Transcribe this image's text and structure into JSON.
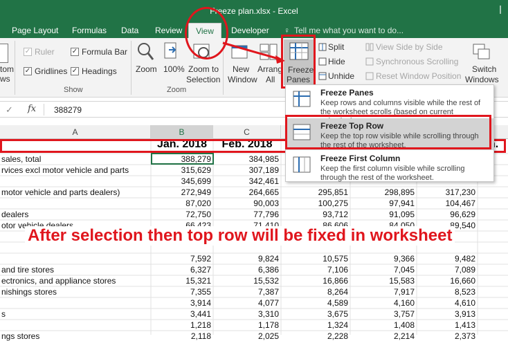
{
  "window": {
    "title": "Freeze plan.xlsx - Excel"
  },
  "tabs": [
    {
      "label": "Page Layout"
    },
    {
      "label": "Formulas"
    },
    {
      "label": "Data"
    },
    {
      "label": "Review"
    },
    {
      "label": "View",
      "active": true
    },
    {
      "label": "Developer"
    }
  ],
  "tell_me": {
    "placeholder": "Tell me what you want to do..."
  },
  "ribbon": {
    "workbook_views_partial": [
      "tom",
      "ws"
    ],
    "show": {
      "group": "Show",
      "ruler": "Ruler",
      "formula_bar": "Formula Bar",
      "gridlines": "Gridlines",
      "headings": "Headings"
    },
    "zoom": {
      "group": "Zoom",
      "zoom": "Zoom",
      "zoom100": "100%",
      "zoom_sel_1": "Zoom to",
      "zoom_sel_2": "Selection"
    },
    "window": {
      "new_window_1": "New",
      "new_window_2": "Window",
      "arrange_1": "Arrang",
      "arrange_2": "All",
      "freeze_1": "Freeze",
      "freeze_2": "Panes",
      "split": "Split",
      "hide": "Hide",
      "unhide": "Unhide",
      "view_side": "View Side by Side",
      "sync_scroll": "Synchronous Scrolling",
      "reset_pos": "Reset Window Position",
      "switch_1": "Switch",
      "switch_2": "Windows"
    }
  },
  "formula_bar": {
    "cancel": "✓",
    "fx": "fx",
    "value": "388279"
  },
  "columns": [
    "A",
    "B",
    "C"
  ],
  "sheet": {
    "header_b": "Jan. 2018",
    "header_c": "Feb. 2018",
    "header_right": "n.",
    "rows": [
      {
        "a": "sales, total",
        "b": "388,279",
        "c": "384,985"
      },
      {
        "a": "rvices excl motor vehicle and parts",
        "b": "315,629",
        "c": "307,189"
      },
      {
        "a": "",
        "b": "345,699",
        "c": "342,461"
      },
      {
        "a": "motor vehicle and parts dealers)",
        "b": "272,949",
        "c": "264,665",
        "d": "295,851",
        "e": "298,895",
        "f": "317,230"
      },
      {
        "a": "",
        "b": "87,020",
        "c": "90,003",
        "d": "100,275",
        "e": "97,941",
        "f": "104,467"
      },
      {
        "a": "dealers",
        "b": "72,750",
        "c": "77,796",
        "d": "93,712",
        "e": "91,095",
        "f": "96,629"
      },
      {
        "a": "otor vehicle dealers",
        "b": "66,423",
        "c": "71,410",
        "d": "86,606",
        "e": "84,050",
        "f": "89,540"
      },
      {
        "a": "",
        "b": "7,592",
        "c": "9,824",
        "d": "10,575",
        "e": "9,366",
        "f": "9,482"
      },
      {
        "a": "and tire stores",
        "b": "6,327",
        "c": "6,386",
        "d": "7,106",
        "e": "7,045",
        "f": "7,089"
      },
      {
        "a": "ectronics, and appliance stores",
        "b": "15,321",
        "c": "15,532",
        "d": "16,866",
        "e": "15,583",
        "f": "16,660"
      },
      {
        "a": "nishings stores",
        "b": "7,355",
        "c": "7,387",
        "d": "8,264",
        "e": "7,917",
        "f": "8,523"
      },
      {
        "a": "",
        "b": "3,914",
        "c": "4,077",
        "d": "4,589",
        "e": "4,160",
        "f": "4,610"
      },
      {
        "a": "s",
        "b": "3,441",
        "c": "3,310",
        "d": "3,675",
        "e": "3,757",
        "f": "3,913"
      },
      {
        "a": "",
        "b": "1,218",
        "c": "1,178",
        "d": "1,324",
        "e": "1,408",
        "f": "1,413"
      },
      {
        "a": "ngs stores",
        "b": "2,118",
        "c": "2,025",
        "d": "2,228",
        "e": "2,214",
        "f": "2,373"
      }
    ]
  },
  "freeze_menu": [
    {
      "title": "Freeze Panes",
      "desc": "Keep rows and columns visible while the rest of the worksheet scrolls (based on current selection)."
    },
    {
      "title": "Freeze Top Row",
      "desc": "Keep the top row visible while scrolling through the rest of the worksheet."
    },
    {
      "title": "Freeze First Column",
      "desc": "Keep the first column visible while scrolling through the rest of the worksheet."
    }
  ],
  "annotation": {
    "caption": "After selection then top row will be fixed in worksheet"
  },
  "colors": {
    "excel_green": "#217346",
    "annotation_red": "#e0161d",
    "highlight": "#d3d3d3"
  }
}
